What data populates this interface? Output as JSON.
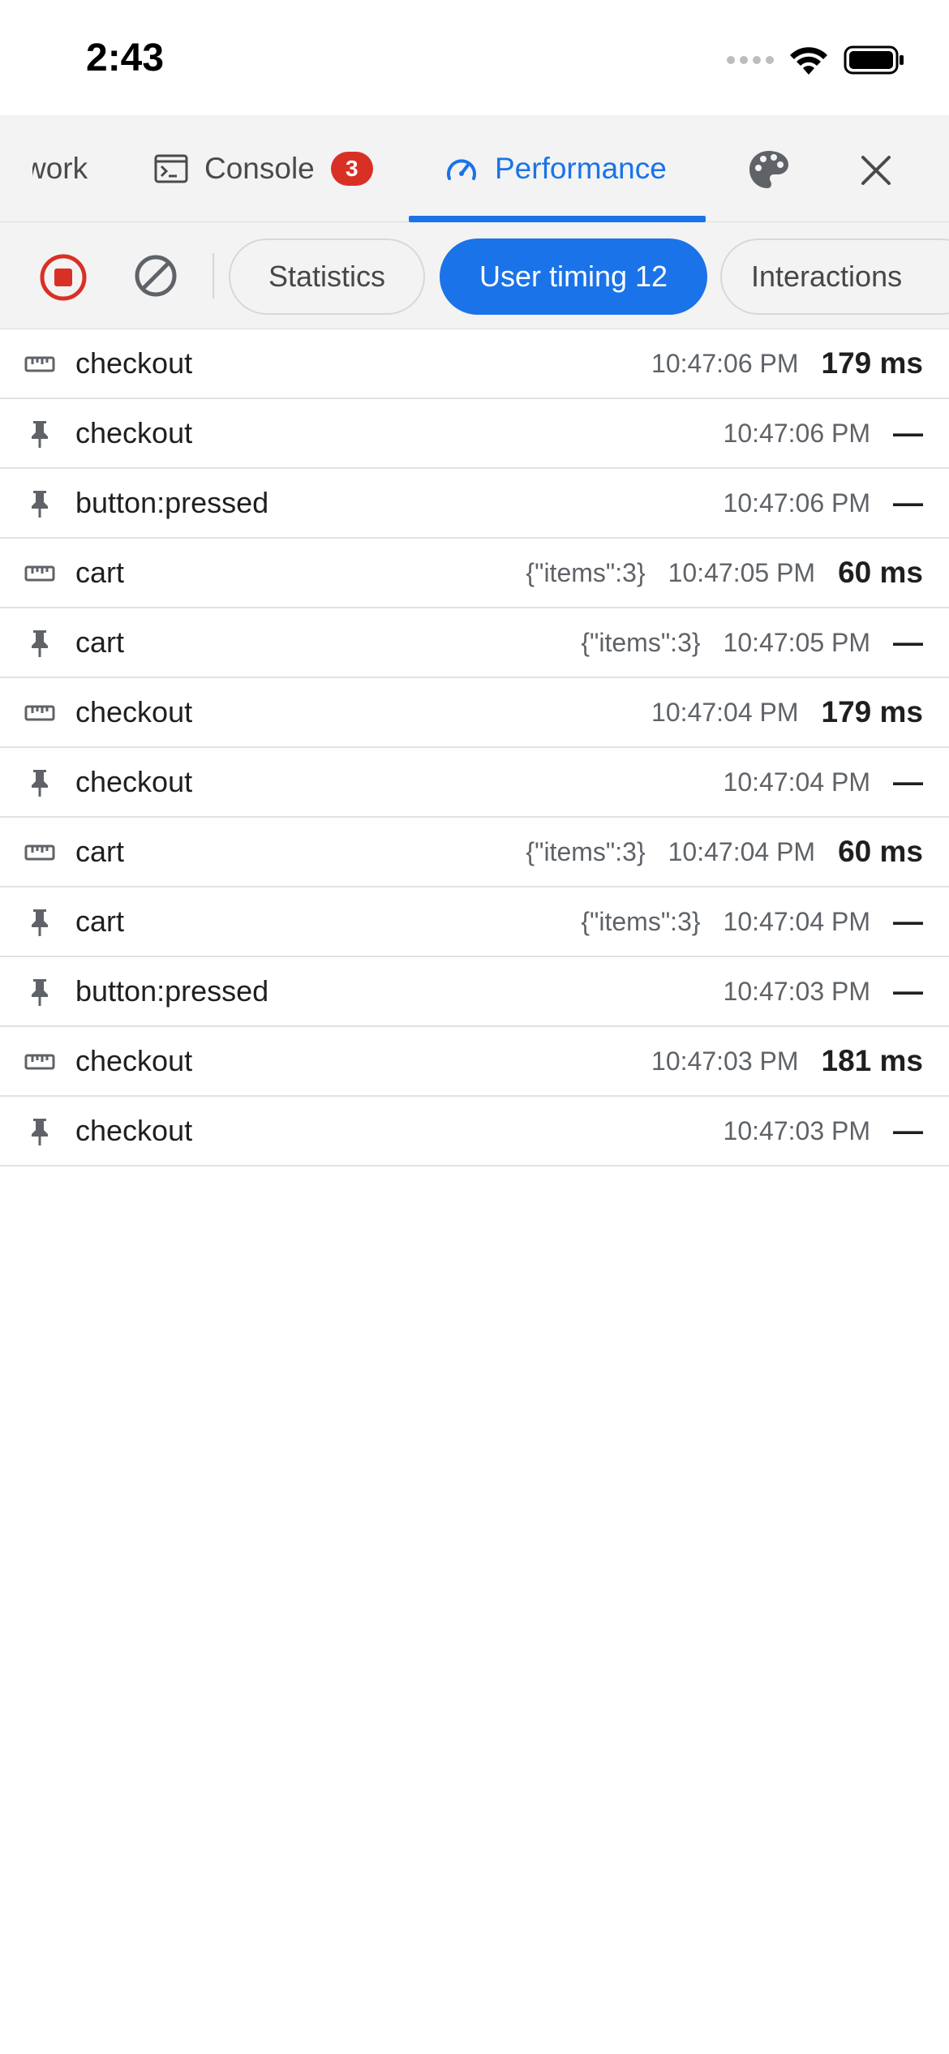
{
  "status_bar": {
    "time": "2:43"
  },
  "tabs": {
    "network_label": "work",
    "console_label": "Console",
    "console_badge": "3",
    "performance_label": "Performance"
  },
  "toolbar": {
    "chips": {
      "statistics": "Statistics",
      "user_timing": "User timing 12",
      "interactions": "Interactions"
    }
  },
  "colors": {
    "accent": "#1a73e8",
    "record_red": "#d93025",
    "badge_red": "#d93025"
  },
  "rows": [
    {
      "icon": "ruler-icon",
      "name": "checkout",
      "detail": "",
      "time": "10:47:06 PM",
      "duration": "179 ms"
    },
    {
      "icon": "pin-icon",
      "name": "checkout",
      "detail": "",
      "time": "10:47:06 PM",
      "duration": "—"
    },
    {
      "icon": "pin-icon",
      "name": "button:pressed",
      "detail": "",
      "time": "10:47:06 PM",
      "duration": "—"
    },
    {
      "icon": "ruler-icon",
      "name": "cart",
      "detail": "{\"items\":3}",
      "time": "10:47:05 PM",
      "duration": "60 ms"
    },
    {
      "icon": "pin-icon",
      "name": "cart",
      "detail": "{\"items\":3}",
      "time": "10:47:05 PM",
      "duration": "—"
    },
    {
      "icon": "ruler-icon",
      "name": "checkout",
      "detail": "",
      "time": "10:47:04 PM",
      "duration": "179 ms"
    },
    {
      "icon": "pin-icon",
      "name": "checkout",
      "detail": "",
      "time": "10:47:04 PM",
      "duration": "—"
    },
    {
      "icon": "ruler-icon",
      "name": "cart",
      "detail": "{\"items\":3}",
      "time": "10:47:04 PM",
      "duration": "60 ms"
    },
    {
      "icon": "pin-icon",
      "name": "cart",
      "detail": "{\"items\":3}",
      "time": "10:47:04 PM",
      "duration": "—"
    },
    {
      "icon": "pin-icon",
      "name": "button:pressed",
      "detail": "",
      "time": "10:47:03 PM",
      "duration": "—"
    },
    {
      "icon": "ruler-icon",
      "name": "checkout",
      "detail": "",
      "time": "10:47:03 PM",
      "duration": "181 ms"
    },
    {
      "icon": "pin-icon",
      "name": "checkout",
      "detail": "",
      "time": "10:47:03 PM",
      "duration": "—"
    }
  ]
}
